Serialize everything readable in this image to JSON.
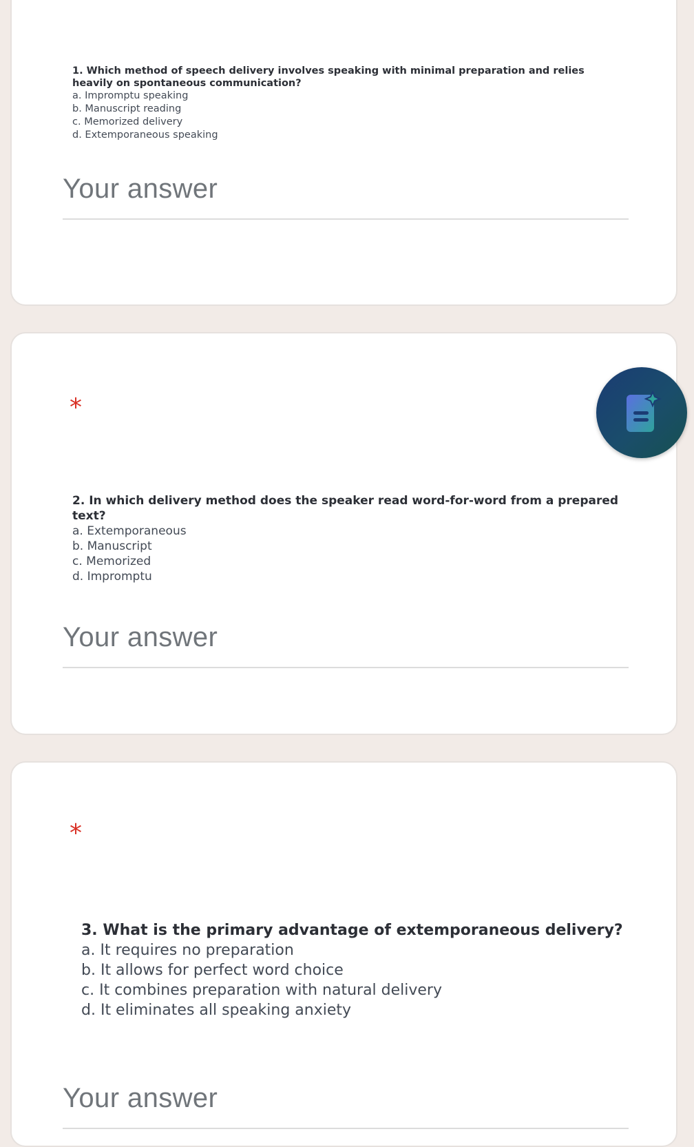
{
  "questions": [
    {
      "text": "1. Which method of speech delivery involves speaking with minimal preparation and relies heavily on spontaneous communication?",
      "options": [
        "a. Impromptu speaking",
        "b. Manuscript reading",
        "c. Memorized delivery",
        "d. Extemporaneous speaking"
      ],
      "answer_placeholder": "Your answer"
    },
    {
      "required_mark": "*",
      "text": "2. In which delivery method does the speaker read word-for-word from a prepared text?",
      "options": [
        "a. Extemporaneous",
        "b. Manuscript",
        "c. Memorized",
        "d. Impromptu"
      ],
      "answer_placeholder": "Your answer"
    },
    {
      "required_mark": "*",
      "text": "3. What is the primary advantage of extemporaneous delivery?",
      "options": [
        "a. It requires no preparation",
        "b. It allows for perfect word choice",
        "c. It combines preparation with natural delivery",
        "d. It eliminates all speaking anxiety"
      ],
      "answer_placeholder": "Your answer"
    }
  ],
  "fab": {
    "icon": "document-sparkle-icon"
  },
  "colors": {
    "background": "#f2ebe7",
    "required": "#d93025",
    "fab_gradient_start": "#1b3c74",
    "fab_gradient_end": "#175150",
    "icon_gradient_start": "#5b6fe0",
    "icon_gradient_end": "#2fa39c"
  }
}
